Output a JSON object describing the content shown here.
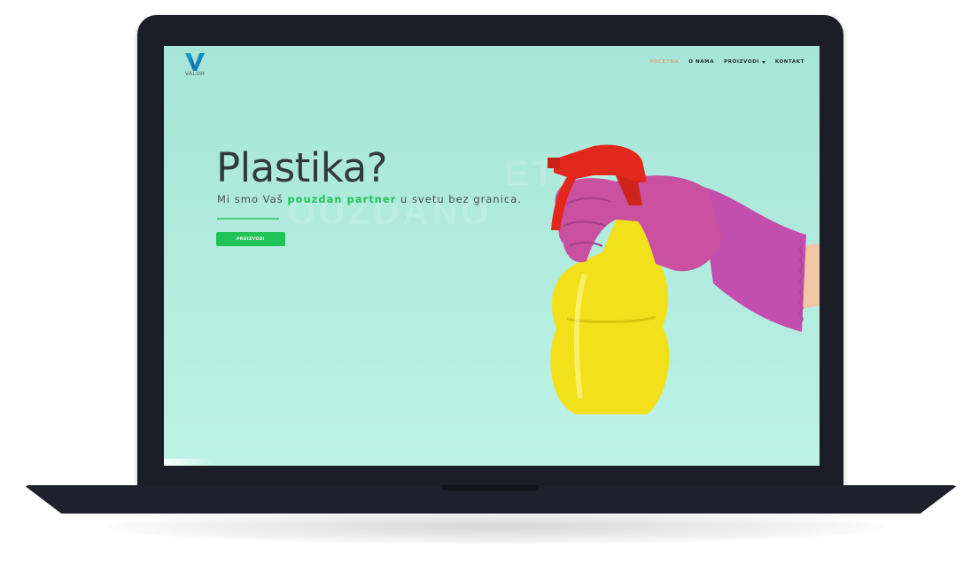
{
  "header": {
    "logo_text": "VALUH",
    "nav": [
      {
        "label": "POČETNA",
        "active": true
      },
      {
        "label": "O NAMA",
        "active": false
      },
      {
        "label": "PROIZVODI",
        "active": false,
        "dropdown": true
      },
      {
        "label": "KONTAKT",
        "active": false
      }
    ]
  },
  "hero": {
    "title": "Plastika?",
    "subtitle_before": "Mi smo Vaš ",
    "subtitle_highlight": "pouzdan partner",
    "subtitle_after": " u svetu bez granica.",
    "button_label": "PROIZVODI",
    "watermark_line1": "ETNA",
    "watermark_line2": "OUZDANO"
  },
  "colors": {
    "background": "#a6e5d8",
    "accent_green": "#20c356",
    "active_nav": "#d9a988",
    "laptop_frame": "#1b1d27"
  },
  "icons": {
    "logo": "v-logo-icon",
    "dropdown": "chevron-down-icon",
    "image": "spray-bottle-glove-image"
  }
}
